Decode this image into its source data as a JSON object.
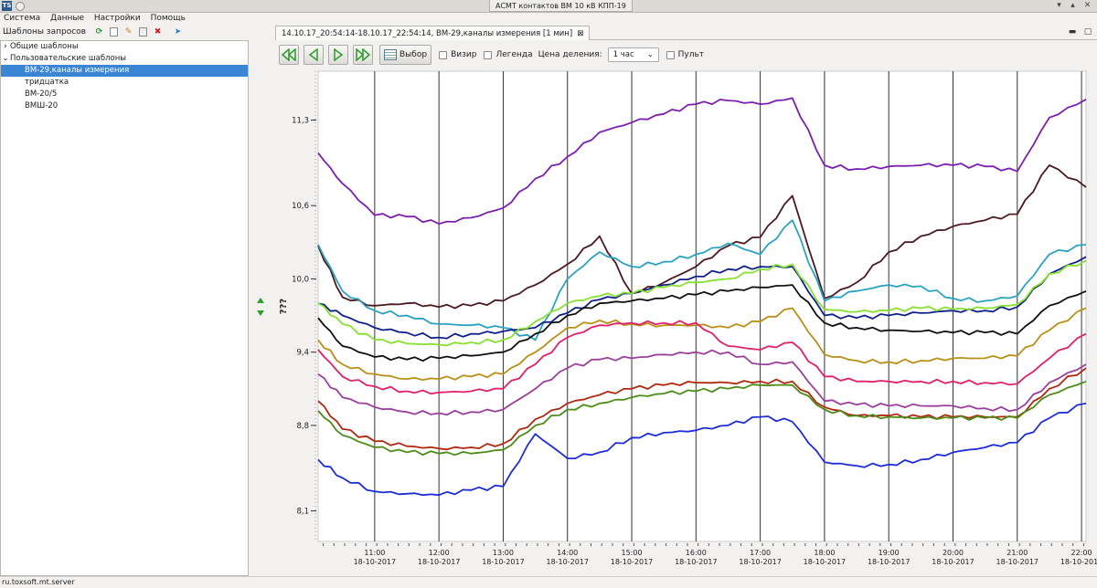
{
  "window": {
    "title": "АСМТ контактов ВМ 10 кВ КПП-19",
    "app_icon": "TS"
  },
  "menu": [
    "Система",
    "Данные",
    "Настройки",
    "Помощь"
  ],
  "left_panel": {
    "title": "Шаблоны запросов",
    "tree": [
      {
        "label": "Общие шаблоны",
        "level": 0,
        "expanded": false,
        "selected": false
      },
      {
        "label": "Пользовательские шаблоны",
        "level": 0,
        "expanded": true,
        "selected": false
      },
      {
        "label": "ВМ-29,каналы измерения",
        "level": 1,
        "selected": true
      },
      {
        "label": "тридцатка",
        "level": 1,
        "selected": false
      },
      {
        "label": "ВМ-20/5",
        "level": 1,
        "selected": false
      },
      {
        "label": "ВМШ-20",
        "level": 1,
        "selected": false
      }
    ]
  },
  "tab": {
    "label": "14.10.17_20:54:14-18.10.17_22:54:14, ВМ-29,каналы измерения [1 мин]"
  },
  "toolbar": {
    "select_label": "Выбор",
    "vizir_label": "Визир",
    "legend_label": "Легенда",
    "scale_label": "Цена деления:",
    "scale_value": "1 час",
    "remote_label": "Пульт"
  },
  "status_text": "ru.toxsoft.mt.server",
  "colors": {
    "accent": "#3a86d4",
    "nav_green": "#2e9b2e"
  },
  "chart_data": {
    "type": "line",
    "ylabel": "???",
    "ylim": [
      7.85,
      11.7
    ],
    "y_ticks": [
      "11,3",
      "10,6",
      "10,0",
      "9,4",
      "8,8",
      "8,1"
    ],
    "x_ticks": [
      {
        "time": "11:00",
        "date": "18-10-2017"
      },
      {
        "time": "12:00",
        "date": "18-10-2017"
      },
      {
        "time": "13:00",
        "date": "18-10-2017"
      },
      {
        "time": "14:00",
        "date": "18-10-2017"
      },
      {
        "time": "15:00",
        "date": "18-10-2017"
      },
      {
        "time": "16:00",
        "date": "18-10-2017"
      },
      {
        "time": "17:00",
        "date": "18-10-2017"
      },
      {
        "time": "18:00",
        "date": "18-10-2017"
      },
      {
        "time": "19:00",
        "date": "18-10-2017"
      },
      {
        "time": "20:00",
        "date": "18-10-2017"
      },
      {
        "time": "21:00",
        "date": "18-10-2017"
      },
      {
        "time": "22:00",
        "date": "18-10-2017"
      }
    ],
    "x_hours": [
      10.12,
      10.5,
      11,
      11.5,
      12,
      12.5,
      13,
      13.5,
      14,
      14.5,
      15,
      15.5,
      16,
      16.5,
      17,
      17.5,
      18,
      18.5,
      19,
      19.5,
      20,
      20.5,
      21,
      21.5,
      22.07
    ],
    "series": [
      {
        "color": "#7b1fb0",
        "values": [
          11.03,
          10.78,
          10.52,
          10.51,
          10.45,
          10.5,
          10.58,
          10.82,
          11.0,
          11.2,
          11.28,
          11.35,
          11.43,
          11.46,
          11.43,
          11.48,
          10.93,
          10.9,
          10.92,
          10.93,
          10.93,
          10.92,
          10.88,
          11.32,
          11.47
        ]
      },
      {
        "color": "#4a1a20",
        "values": [
          10.27,
          9.85,
          9.78,
          9.8,
          9.77,
          9.78,
          9.82,
          9.95,
          10.12,
          10.35,
          9.88,
          9.97,
          10.1,
          10.27,
          10.34,
          10.68,
          9.84,
          9.97,
          10.22,
          10.35,
          10.43,
          10.48,
          10.53,
          10.93,
          10.75
        ]
      },
      {
        "color": "#2aa3c0",
        "values": [
          10.28,
          9.9,
          9.74,
          9.7,
          9.63,
          9.62,
          9.6,
          9.5,
          10.0,
          10.22,
          10.1,
          10.14,
          10.2,
          10.29,
          10.2,
          10.48,
          9.82,
          9.9,
          9.95,
          9.94,
          9.84,
          9.82,
          9.86,
          10.2,
          10.28
        ]
      },
      {
        "color": "#10208a",
        "values": [
          9.8,
          9.7,
          9.6,
          9.56,
          9.52,
          9.55,
          9.57,
          9.6,
          9.72,
          9.83,
          9.88,
          9.95,
          10.02,
          10.08,
          10.1,
          10.1,
          9.7,
          9.68,
          9.7,
          9.72,
          9.74,
          9.74,
          9.77,
          10.04,
          10.18
        ]
      },
      {
        "color": "#88e030",
        "values": [
          9.8,
          9.63,
          9.5,
          9.47,
          9.46,
          9.48,
          9.5,
          9.65,
          9.8,
          9.86,
          9.88,
          9.93,
          9.97,
          10.0,
          10.08,
          10.12,
          9.75,
          9.73,
          9.74,
          9.76,
          9.75,
          9.76,
          9.79,
          10.04,
          10.15
        ]
      },
      {
        "color": "#101010",
        "values": [
          9.68,
          9.45,
          9.36,
          9.34,
          9.35,
          9.37,
          9.4,
          9.55,
          9.7,
          9.8,
          9.82,
          9.84,
          9.87,
          9.9,
          9.93,
          9.95,
          9.64,
          9.6,
          9.58,
          9.57,
          9.56,
          9.56,
          9.55,
          9.78,
          9.9
        ]
      },
      {
        "color": "#b89018",
        "values": [
          9.5,
          9.3,
          9.22,
          9.18,
          9.18,
          9.2,
          9.22,
          9.4,
          9.6,
          9.66,
          9.63,
          9.62,
          9.62,
          9.6,
          9.65,
          9.76,
          9.38,
          9.33,
          9.32,
          9.33,
          9.35,
          9.35,
          9.37,
          9.58,
          9.76
        ]
      },
      {
        "color": "#e0206a",
        "values": [
          9.42,
          9.2,
          9.12,
          9.08,
          9.07,
          9.08,
          9.1,
          9.3,
          9.52,
          9.62,
          9.64,
          9.64,
          9.64,
          9.45,
          9.42,
          9.48,
          9.2,
          9.16,
          9.16,
          9.16,
          9.16,
          9.15,
          9.14,
          9.35,
          9.55
        ]
      },
      {
        "color": "#9c3f9c",
        "values": [
          9.22,
          9.03,
          8.95,
          8.91,
          8.9,
          8.91,
          8.93,
          9.1,
          9.27,
          9.34,
          9.35,
          9.38,
          9.4,
          9.4,
          9.3,
          9.32,
          9.0,
          8.97,
          8.96,
          8.96,
          8.96,
          8.94,
          8.93,
          9.15,
          9.3
        ]
      },
      {
        "color": "#b02810",
        "values": [
          9.0,
          8.77,
          8.67,
          8.63,
          8.61,
          8.62,
          8.65,
          8.85,
          8.98,
          9.05,
          9.1,
          9.13,
          9.15,
          9.15,
          9.16,
          9.16,
          8.95,
          8.88,
          8.88,
          8.87,
          8.87,
          8.87,
          8.87,
          9.1,
          9.27
        ]
      },
      {
        "color": "#4c8c18",
        "values": [
          8.92,
          8.72,
          8.62,
          8.58,
          8.57,
          8.57,
          8.6,
          8.8,
          8.93,
          8.98,
          9.03,
          9.06,
          9.08,
          9.1,
          9.13,
          9.13,
          8.93,
          8.88,
          8.87,
          8.86,
          8.86,
          8.86,
          8.86,
          9.05,
          9.16
        ]
      },
      {
        "color": "#1c2cd8",
        "values": [
          8.52,
          8.37,
          8.26,
          8.24,
          8.23,
          8.27,
          8.3,
          8.73,
          8.53,
          8.58,
          8.7,
          8.74,
          8.76,
          8.8,
          8.87,
          8.83,
          8.5,
          8.47,
          8.48,
          8.52,
          8.58,
          8.62,
          8.66,
          8.86,
          8.98
        ]
      }
    ]
  }
}
